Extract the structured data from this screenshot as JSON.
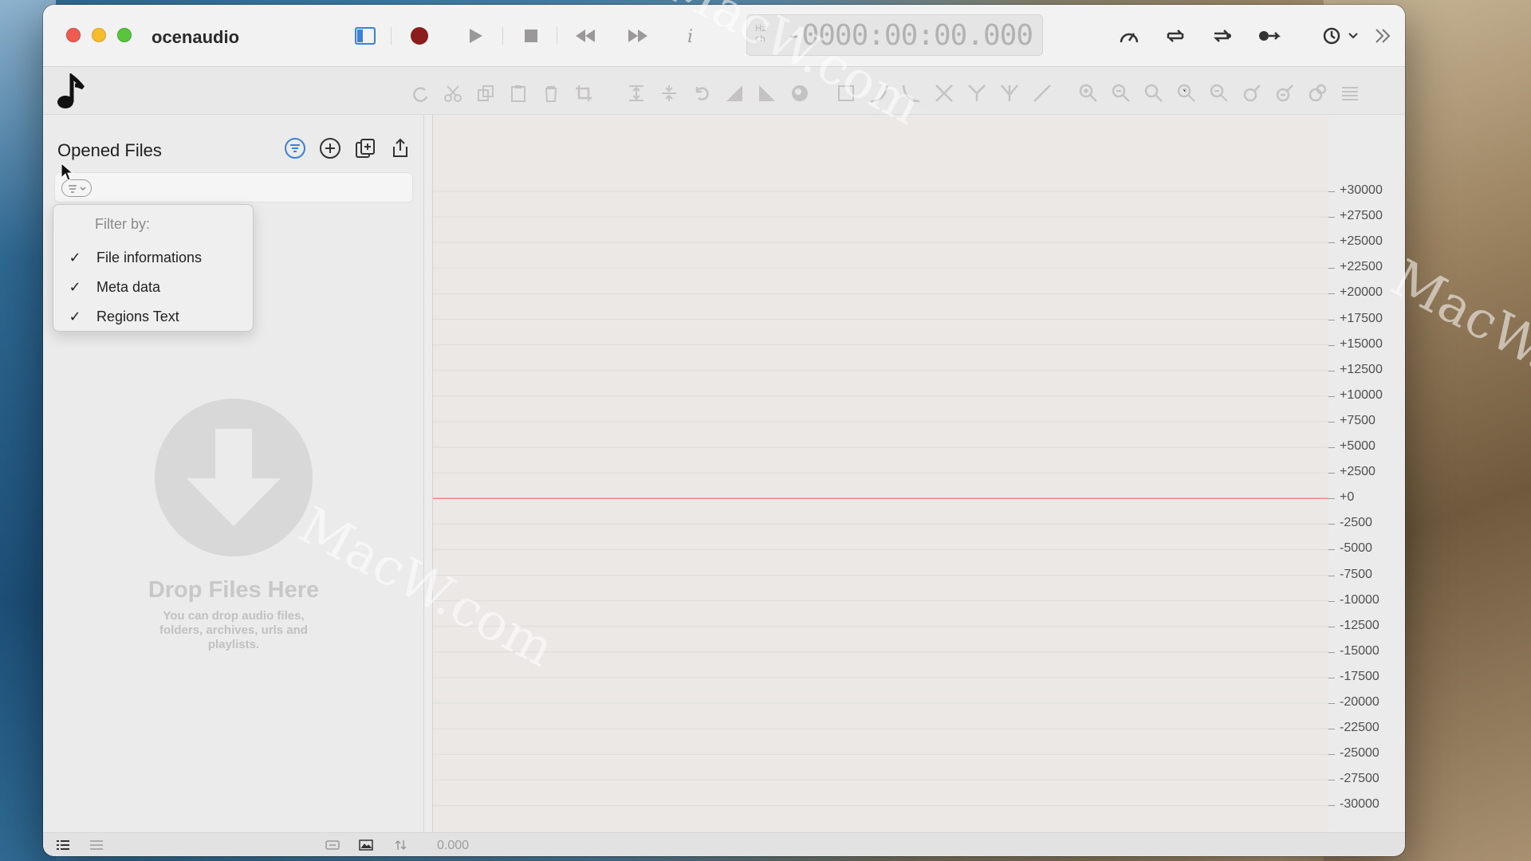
{
  "app": {
    "title": "ocenaudio"
  },
  "transport": {
    "time": "-0000:00:00.000",
    "unit_label": "Hz\nch"
  },
  "sidebar": {
    "title": "Opened Files",
    "drop": {
      "title": "Drop Files Here",
      "subtitle": "You can drop audio files, folders, archives, urls and playlists."
    }
  },
  "filter_menu": {
    "header": "Filter by:",
    "items": [
      {
        "label": "File informations",
        "checked": true
      },
      {
        "label": "Meta data",
        "checked": true
      },
      {
        "label": "Regions Text",
        "checked": true
      }
    ]
  },
  "scale": {
    "labels": [
      "+30000",
      "+27500",
      "+25000",
      "+22500",
      "+20000",
      "+17500",
      "+15000",
      "+12500",
      "+10000",
      "+7500",
      "+5000",
      "+2500",
      "+0",
      "-2500",
      "-5000",
      "-7500",
      "-10000",
      "-12500",
      "-15000",
      "-17500",
      "-20000",
      "-22500",
      "-25000",
      "-27500",
      "-30000"
    ]
  },
  "status": {
    "time": "0.000"
  },
  "watermark": "MacW.com",
  "colors": {
    "zero_line": "#e58c83",
    "record": "#8b1d1d",
    "accent": "#3b82d6"
  }
}
